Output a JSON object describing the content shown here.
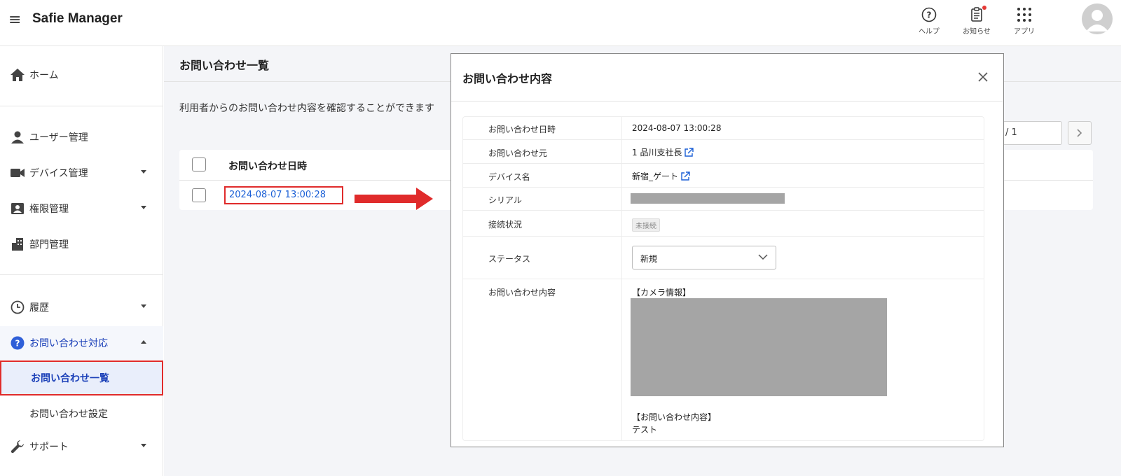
{
  "header": {
    "app_title": "Safie Manager",
    "help_label": "ヘルプ",
    "notice_label": "お知らせ",
    "apps_label": "アプリ"
  },
  "sidebar": {
    "home": "ホーム",
    "users": "ユーザー管理",
    "devices": "デバイス管理",
    "permissions": "権限管理",
    "departments": "部門管理",
    "history": "履歴",
    "inquiry_support": "お問い合わせ対応",
    "inquiry_list": "お問い合わせ一覧",
    "inquiry_settings": "お問い合わせ設定",
    "support": "サポート"
  },
  "main": {
    "page_title": "お問い合わせ一覧",
    "description": "利用者からのお問い合わせ内容を確認することができます",
    "pager_value": "/ 1",
    "table": {
      "header": "お問い合わせ日時",
      "rows": [
        {
          "date": "2024-08-07 13:00:28"
        }
      ]
    }
  },
  "modal": {
    "title": "お問い合わせ内容",
    "fields": {
      "datetime_label": "お問い合わせ日時",
      "datetime_value": "2024-08-07 13:00:28",
      "source_label": "お問い合わせ元",
      "source_value": "1 品川支社長",
      "device_label": "デバイス名",
      "device_value": "新宿_ゲート",
      "serial_label": "シリアル",
      "connection_label": "接続状況",
      "connection_value": "未接続",
      "status_label": "ステータス",
      "status_value": "新規",
      "content_label": "お問い合わせ内容",
      "camera_info_heading": "【カメラ情報】",
      "content_heading": "【お問い合わせ内容】",
      "content_text": "テスト"
    }
  },
  "colors": {
    "link": "#1a5fd6",
    "highlight_border": "#e02b2b",
    "active_nav": "#1a3fb8",
    "redaction": "#a5a5a5"
  }
}
